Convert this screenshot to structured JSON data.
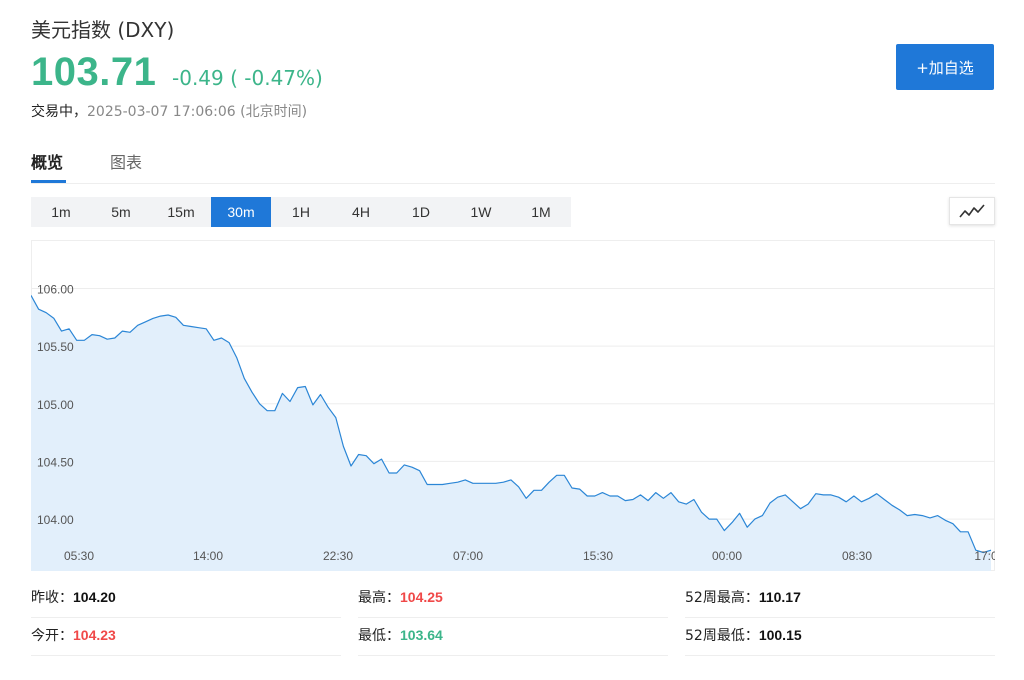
{
  "header": {
    "title": "美元指数 (DXY)",
    "price": "103.71",
    "change": "-0.49 ( -0.47%)",
    "status": "交易中，",
    "timestamp": "2025-03-07 17:06:06 (北京时间)"
  },
  "actions": {
    "add_watchlist": "+加自选"
  },
  "tabs": [
    {
      "label": "概览",
      "active": true
    },
    {
      "label": "图表",
      "active": false
    }
  ],
  "intervals": [
    {
      "label": "1m",
      "active": false
    },
    {
      "label": "5m",
      "active": false
    },
    {
      "label": "15m",
      "active": false
    },
    {
      "label": "30m",
      "active": true
    },
    {
      "label": "1H",
      "active": false
    },
    {
      "label": "4H",
      "active": false
    },
    {
      "label": "1D",
      "active": false
    },
    {
      "label": "1W",
      "active": false
    },
    {
      "label": "1M",
      "active": false
    }
  ],
  "colors": {
    "up": "#f04848",
    "down": "#3cb58a",
    "accent": "#1f78d8",
    "line": "#2b86d6",
    "area": "#e2effb"
  },
  "icons": {
    "chart_type": "line-chart-icon"
  },
  "chart_data": {
    "type": "area",
    "y_ticks": [
      "106.00",
      "105.50",
      "105.00",
      "104.50",
      "104.00"
    ],
    "y_tick_values": [
      106.0,
      105.5,
      105.0,
      104.5,
      104.0
    ],
    "x_ticks": [
      "05:30",
      "14:00",
      "22:30",
      "07:00",
      "15:30",
      "00:00",
      "08:30",
      "17:0"
    ],
    "ylim": [
      103.55,
      106.42
    ],
    "grid": true,
    "values": [
      105.94,
      105.82,
      105.79,
      105.74,
      105.63,
      105.65,
      105.55,
      105.55,
      105.6,
      105.59,
      105.56,
      105.57,
      105.63,
      105.62,
      105.68,
      105.71,
      105.74,
      105.76,
      105.77,
      105.75,
      105.68,
      105.67,
      105.66,
      105.65,
      105.55,
      105.57,
      105.53,
      105.4,
      105.22,
      105.1,
      105.0,
      104.94,
      104.94,
      105.09,
      105.02,
      105.14,
      105.15,
      104.99,
      105.08,
      104.97,
      104.88,
      104.63,
      104.46,
      104.56,
      104.55,
      104.48,
      104.52,
      104.4,
      104.4,
      104.47,
      104.45,
      104.42,
      104.3,
      104.3,
      104.3,
      104.31,
      104.32,
      104.34,
      104.31,
      104.31,
      104.31,
      104.31,
      104.32,
      104.34,
      104.28,
      104.18,
      104.25,
      104.25,
      104.32,
      104.38,
      104.38,
      104.27,
      104.26,
      104.2,
      104.2,
      104.23,
      104.2,
      104.2,
      104.16,
      104.17,
      104.21,
      104.16,
      104.23,
      104.18,
      104.23,
      104.15,
      104.13,
      104.17,
      104.06,
      104.0,
      104.0,
      103.9,
      103.97,
      104.05,
      103.93,
      104.0,
      104.03,
      104.14,
      104.19,
      104.21,
      104.15,
      104.09,
      104.13,
      104.22,
      104.21,
      104.21,
      104.19,
      104.15,
      104.2,
      104.15,
      104.18,
      104.22,
      104.17,
      104.12,
      104.08,
      104.03,
      104.04,
      104.03,
      104.01,
      104.03,
      103.99,
      103.96,
      103.89,
      103.89,
      103.73,
      103.71,
      103.73
    ]
  },
  "stats": [
    {
      "label": "昨收：",
      "value": "104.20",
      "tone": "neutral"
    },
    {
      "label": "最高：",
      "value": "104.25",
      "tone": "up"
    },
    {
      "label": "52周最高：",
      "value": "110.17",
      "tone": "neutral"
    },
    {
      "label": "今开：",
      "value": "104.23",
      "tone": "up"
    },
    {
      "label": "最低：",
      "value": "103.64",
      "tone": "down"
    },
    {
      "label": "52周最低：",
      "value": "100.15",
      "tone": "neutral"
    }
  ]
}
